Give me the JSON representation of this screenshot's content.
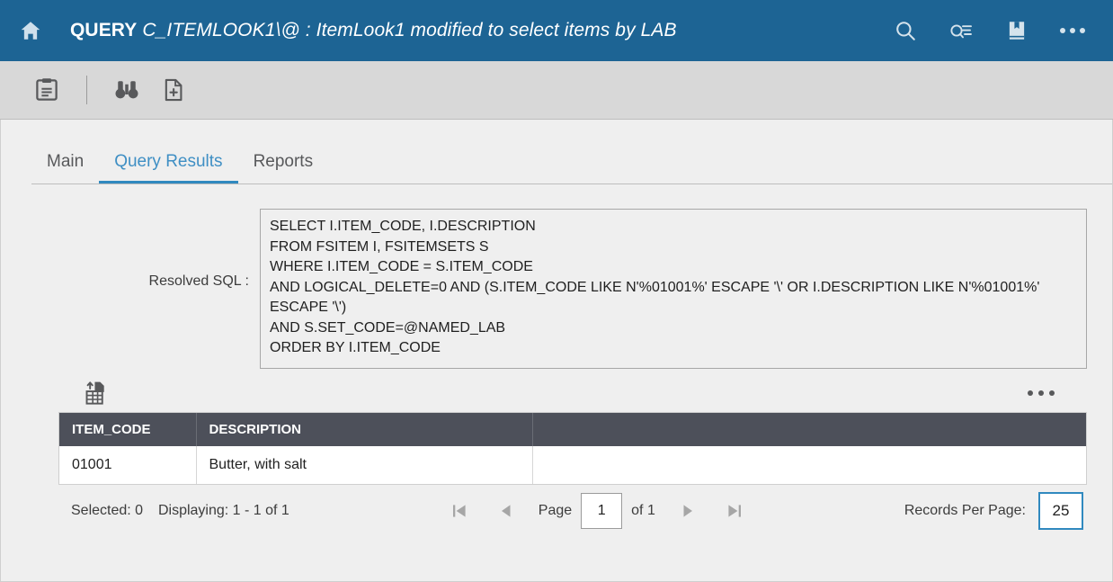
{
  "header": {
    "home_icon": "home-icon",
    "title_keyword": "QUERY",
    "title_name": "C_ITEMLOOK1\\@ : ItemLook1 modified to select items by LAB",
    "actions": [
      {
        "name": "search-icon",
        "label": "Search"
      },
      {
        "name": "query-search-icon",
        "label": "Query Search"
      },
      {
        "name": "book-icon",
        "label": "Book"
      },
      {
        "name": "more-icon",
        "label": "More"
      }
    ],
    "accent_color": "#1d6494"
  },
  "toolbar": {
    "items": [
      {
        "name": "save-icon",
        "label": "Save"
      },
      {
        "name": "find-binoculars-icon",
        "label": "Find"
      },
      {
        "name": "new-document-icon",
        "label": "New"
      }
    ]
  },
  "tabs": [
    {
      "label": "Main",
      "active": false
    },
    {
      "label": "Query Results",
      "active": true
    },
    {
      "label": "Reports",
      "active": false
    }
  ],
  "sql": {
    "label": "Resolved SQL :",
    "text": "SELECT I.ITEM_CODE, I.DESCRIPTION\nFROM FSITEM I, FSITEMSETS S\nWHERE I.ITEM_CODE = S.ITEM_CODE\nAND LOGICAL_DELETE=0 AND (S.ITEM_CODE LIKE N'%01001%' ESCAPE '\\' OR I.DESCRIPTION LIKE N'%01001%' ESCAPE '\\')\nAND S.SET_CODE=@NAMED_LAB\nORDER BY I.ITEM_CODE"
  },
  "grid_tools": {
    "export_icon": "export-spreadsheet-icon",
    "more_icon": "grid-more-icon"
  },
  "grid": {
    "columns": [
      "ITEM_CODE",
      "DESCRIPTION",
      ""
    ],
    "rows": [
      [
        "01001",
        "Butter, with salt",
        ""
      ]
    ]
  },
  "pager": {
    "selected_label": "Selected: 0",
    "displaying_label": "Displaying: 1 - 1 of 1",
    "first_icon": "first-page-icon",
    "prev_icon": "previous-page-icon",
    "page_label": "Page",
    "page_value": "1",
    "of_label": "of 1",
    "next_icon": "next-page-icon",
    "last_icon": "last-page-icon",
    "records_label": "Records Per Page:",
    "records_value": "25",
    "focus_color": "#3089bf"
  }
}
